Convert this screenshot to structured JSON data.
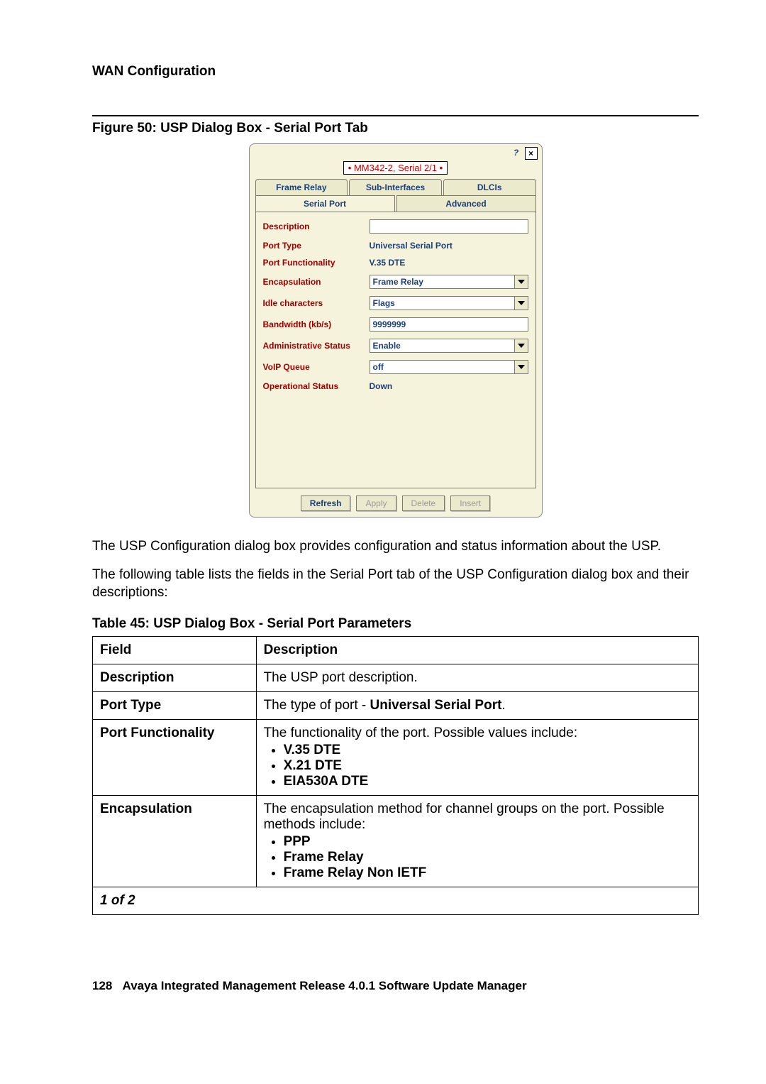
{
  "page": {
    "heading": "WAN Configuration",
    "figure_caption": "Figure 50: USP Dialog Box - Serial Port Tab",
    "para1": "The USP Configuration dialog box provides configuration and status information about the USP.",
    "para2": "The following table lists the fields in the Serial Port tab of the USP Configuration dialog box and their descriptions:",
    "table_caption": "Table 45: USP Dialog Box - Serial Port Parameters",
    "footer_page": "128",
    "footer_text": "Avaya Integrated Management Release 4.0.1 Software Update Manager"
  },
  "dialog": {
    "title_anim": "•",
    "title_name": "MM342-2, Serial 2/1",
    "tabs_row1": [
      "Frame Relay",
      "Sub-Interfaces",
      "DLCIs"
    ],
    "tabs_row2": [
      "Serial Port",
      "Advanced"
    ],
    "active_tab": "Serial Port",
    "fields": {
      "description": {
        "label": "Description",
        "value": ""
      },
      "port_type": {
        "label": "Port Type",
        "value": "Universal Serial Port"
      },
      "port_functionality": {
        "label": "Port Functionality",
        "value": "V.35 DTE"
      },
      "encapsulation": {
        "label": "Encapsulation",
        "value": "Frame Relay"
      },
      "idle_characters": {
        "label": "Idle characters",
        "value": "Flags"
      },
      "bandwidth": {
        "label": "Bandwidth (kb/s)",
        "value": "9999999"
      },
      "admin_status": {
        "label": "Administrative Status",
        "value": "Enable"
      },
      "voip_queue": {
        "label": "VoIP Queue",
        "value": "off"
      },
      "oper_status": {
        "label": "Operational Status",
        "value": "Down"
      }
    },
    "buttons": {
      "refresh": "Refresh",
      "apply": "Apply",
      "delete": "Delete",
      "insert": "Insert"
    }
  },
  "table": {
    "head_field": "Field",
    "head_desc": "Description",
    "rows": [
      {
        "field": "Description",
        "desc": "The USP port description."
      },
      {
        "field": "Port Type",
        "desc_pre": "The type of port - ",
        "desc_bold": "Universal Serial Port",
        "desc_post": "."
      },
      {
        "field": "Port Functionality",
        "desc": "The functionality of the port. Possible values include:",
        "bullets": [
          "V.35 DTE",
          "X.21 DTE",
          "EIA530A DTE"
        ]
      },
      {
        "field": "Encapsulation",
        "desc": "The encapsulation method for channel groups on the port. Possible methods include:",
        "bullets": [
          "PPP",
          "Frame Relay",
          "Frame Relay Non IETF"
        ]
      }
    ],
    "pager": "1 of 2"
  }
}
